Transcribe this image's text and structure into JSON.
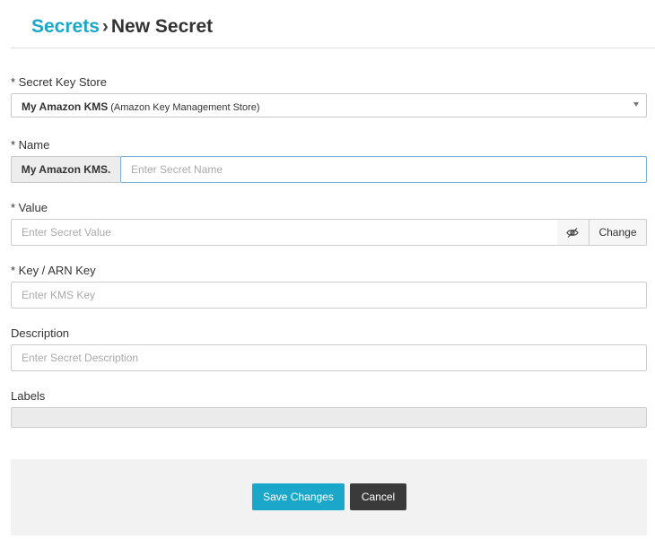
{
  "header": {
    "breadcrumb_parent": "Secrets",
    "separator": "›",
    "current": "New Secret"
  },
  "form": {
    "key_store": {
      "label": "* Secret Key Store",
      "selected_name": "My Amazon KMS",
      "selected_type": "(Amazon Key Management Store)"
    },
    "name": {
      "label": "* Name",
      "prefix": "My Amazon KMS.",
      "placeholder": "Enter Secret Name",
      "value": ""
    },
    "secret_value": {
      "label": "* Value",
      "placeholder": "Enter Secret Value",
      "value": "",
      "visibility_icon": "eye-slash-icon",
      "change_label": "Change"
    },
    "kms_key": {
      "label": "* Key / ARN Key",
      "placeholder": "Enter KMS Key",
      "value": ""
    },
    "description": {
      "label": "Description",
      "placeholder": "Enter Secret Description",
      "value": ""
    },
    "labels": {
      "label": "Labels"
    }
  },
  "actions": {
    "save_label": "Save Changes",
    "cancel_label": "Cancel"
  },
  "colors": {
    "accent": "#1ba7c9",
    "cancel": "#3a3a3a",
    "focus_border": "#7aaed6"
  }
}
